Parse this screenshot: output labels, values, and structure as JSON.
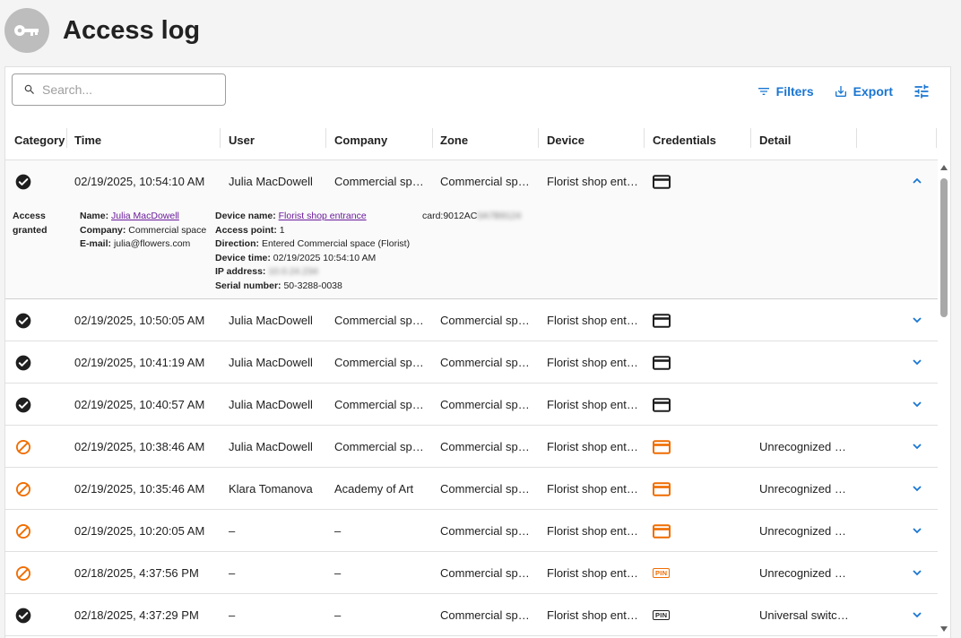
{
  "page": {
    "title": "Access log"
  },
  "search": {
    "placeholder": "Search..."
  },
  "toolbar": {
    "filters_label": "Filters",
    "export_label": "Export"
  },
  "colors": {
    "accent": "#1976d2",
    "denied": "#ef6c00",
    "granted": "#212121"
  },
  "columns": [
    "Category",
    "Time",
    "User",
    "Company",
    "Zone",
    "Device",
    "Credentials",
    "Detail"
  ],
  "rows": [
    {
      "status": "granted",
      "time": "02/19/2025, 10:54:10 AM",
      "user": "Julia MacDowell",
      "company": "Commercial space",
      "zone": "Commercial space",
      "device": "Florist shop entrance",
      "credential": "card",
      "detail": "",
      "expanded": true
    },
    {
      "status": "granted",
      "time": "02/19/2025, 10:50:05 AM",
      "user": "Julia MacDowell",
      "company": "Commercial space",
      "zone": "Commercial space",
      "device": "Florist shop entrance",
      "credential": "card",
      "detail": ""
    },
    {
      "status": "granted",
      "time": "02/19/2025, 10:41:19 AM",
      "user": "Julia MacDowell",
      "company": "Commercial space",
      "zone": "Commercial space",
      "device": "Florist shop entrance",
      "credential": "card",
      "detail": ""
    },
    {
      "status": "granted",
      "time": "02/19/2025, 10:40:57 AM",
      "user": "Julia MacDowell",
      "company": "Commercial space",
      "zone": "Commercial space",
      "device": "Florist shop entrance",
      "credential": "card",
      "detail": ""
    },
    {
      "status": "denied",
      "time": "02/19/2025, 10:38:46 AM",
      "user": "Julia MacDowell",
      "company": "Commercial space",
      "zone": "Commercial space",
      "device": "Florist shop entrance",
      "credential": "card",
      "detail": "Unrecognized credential"
    },
    {
      "status": "denied",
      "time": "02/19/2025, 10:35:46 AM",
      "user": "Klara Tomanova",
      "company": "Academy of Art",
      "zone": "Commercial space",
      "device": "Florist shop entrance",
      "credential": "card",
      "detail": "Unrecognized credential"
    },
    {
      "status": "denied",
      "time": "02/19/2025, 10:20:05 AM",
      "user": "–",
      "company": "–",
      "zone": "Commercial space",
      "device": "Florist shop entrance",
      "credential": "card",
      "detail": "Unrecognized credential"
    },
    {
      "status": "denied",
      "time": "02/18/2025, 4:37:56 PM",
      "user": "–",
      "company": "–",
      "zone": "Commercial space",
      "device": "Florist shop entrance",
      "credential": "pin",
      "detail": "Unrecognized credential"
    },
    {
      "status": "granted",
      "time": "02/18/2025, 4:37:29 PM",
      "user": "–",
      "company": "–",
      "zone": "Commercial space",
      "device": "Florist shop entrance",
      "credential": "pin",
      "detail": "Universal switch code"
    }
  ],
  "expanded_detail": {
    "category_label": "Access granted",
    "name_label": "Name:",
    "name_value": "Julia MacDowell",
    "company_label": "Company:",
    "company_value": "Commercial space",
    "email_label": "E-mail:",
    "email_value": "julia@flowers.com",
    "device_name_label": "Device name:",
    "device_name_value": "Florist shop entrance",
    "access_point_label": "Access point:",
    "access_point_value": "1",
    "direction_label": "Direction:",
    "direction_value": "Entered Commercial space (Florist)",
    "device_time_label": "Device time:",
    "device_time_value": "02/19/2025 10:54:10 AM",
    "ip_label": "IP address:",
    "ip_value": "10.0.24.234",
    "serial_label": "Serial number:",
    "serial_value": "50-3288-0038",
    "card_prefix": "card:9012AC",
    "card_hidden": "0A7B9124",
    "pin_label": "PIN"
  }
}
